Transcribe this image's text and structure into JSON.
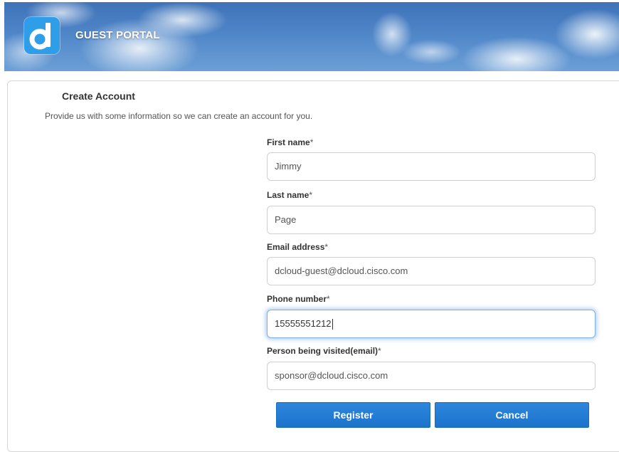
{
  "header": {
    "title": "GUEST PORTAL",
    "logo_icon": "dcloud-d-logo-icon",
    "logo_color": "#2f9ee8"
  },
  "form": {
    "title": "Create Account",
    "description": "Provide us with some information so we can create an account for you.",
    "required_marker": "*",
    "fields": [
      {
        "label": "First name",
        "value": "Jimmy"
      },
      {
        "label": "Last name",
        "value": "Page"
      },
      {
        "label": "Email address",
        "value": "dcloud-guest@dcloud.cisco.com"
      },
      {
        "label": "Phone number",
        "value": "15555551212",
        "focused": true
      },
      {
        "label": "Person being visited(email)",
        "value": "sponsor@dcloud.cisco.com"
      }
    ]
  },
  "buttons": {
    "register_label": "Register",
    "cancel_label": "Cancel",
    "accent_color": "#2281d6"
  }
}
